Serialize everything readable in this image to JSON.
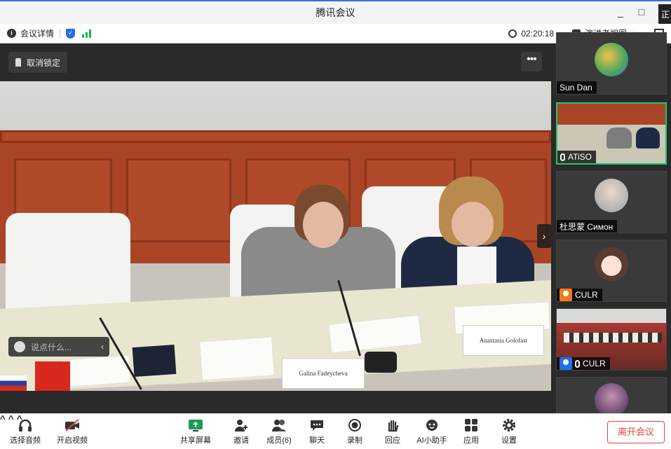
{
  "window": {
    "title": "腾讯会议",
    "minimize": "_",
    "maximize": "□",
    "edge_label": "正"
  },
  "infobar": {
    "meeting_info": "会议详情",
    "timer": "02:20:18",
    "view_mode": "演讲者视图"
  },
  "stage": {
    "unpin_label": "取消锁定",
    "more_label": "•••",
    "chat_placeholder": "说点什么...",
    "nameplates": [
      "Galina Fadeycheva",
      "Anastasia Golofast"
    ]
  },
  "participants": [
    {
      "name": "Sun Dan"
    },
    {
      "name": "ATiSO"
    },
    {
      "name": "杜思蒙 Симон"
    },
    {
      "name": "CULR"
    },
    {
      "name": "CULR"
    },
    {
      "name": ""
    }
  ],
  "toolbar": {
    "audio": "选择音频",
    "video": "开启视频",
    "share": "共享屏幕",
    "invite": "邀请",
    "members": "成员(6)",
    "chat": "聊天",
    "record": "录制",
    "react": "回应",
    "ai": "AI小助手",
    "apps": "应用",
    "settings": "设置",
    "leave": "离开会议"
  },
  "colors": {
    "active_border": "#1fc66a",
    "leave": "#e0463c",
    "accent": "#1f6fe8"
  }
}
